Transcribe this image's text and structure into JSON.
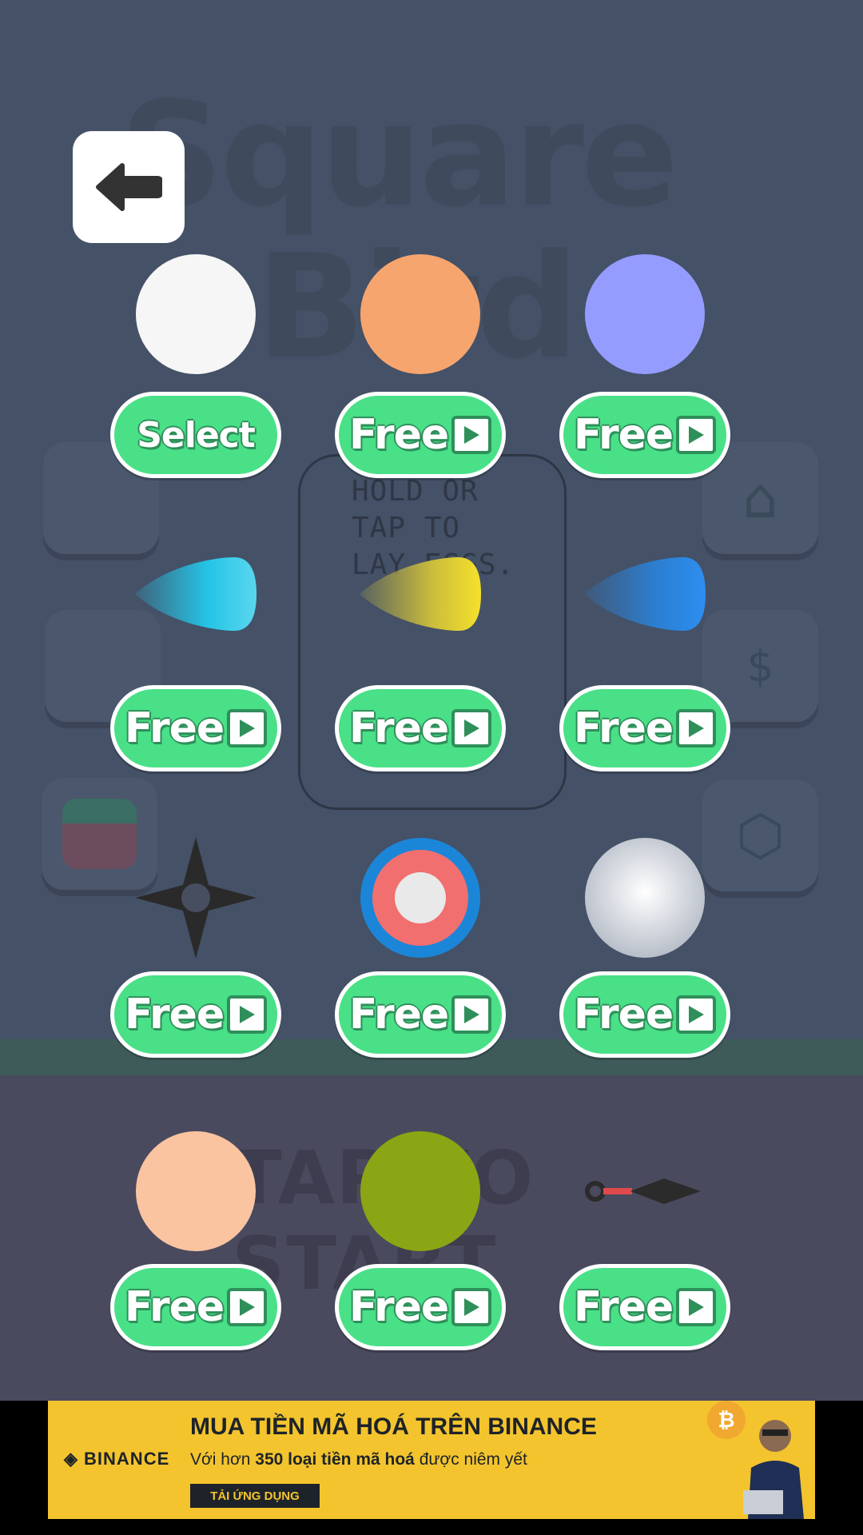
{
  "background": {
    "title_line1": "Square",
    "title_line2": "Bird",
    "hint": "HOLD OR TAP TO LAY EGGS.",
    "tap_to_start": "TAP TO START"
  },
  "back_button": {
    "icon": "arrow-left-icon"
  },
  "skins": [
    {
      "shape": "circle",
      "colors": [
        "#f6f6f6",
        "#e4e4e4"
      ],
      "button": "Select",
      "video": false
    },
    {
      "shape": "circle",
      "colors": [
        "#f7a56e",
        "#f58a6a"
      ],
      "button": "Free",
      "video": true
    },
    {
      "shape": "circle",
      "colors": [
        "#959cff",
        "#8c93f8"
      ],
      "button": "Free",
      "video": true
    },
    {
      "shape": "drop",
      "colors": [
        "#25c4e6",
        "#5ad6ef"
      ],
      "button": "Free",
      "video": true
    },
    {
      "shape": "drop",
      "colors": [
        "#cbbd3c",
        "#f5e12b"
      ],
      "button": "Free",
      "video": true
    },
    {
      "shape": "drop",
      "colors": [
        "#2c7fd2",
        "#2d8ef0"
      ],
      "button": "Free",
      "video": true
    },
    {
      "shape": "shuriken",
      "colors": [
        "#2a2a2a",
        "#1a1a1a"
      ],
      "button": "Free",
      "video": true
    },
    {
      "shape": "target",
      "colors": [
        "#1b86d8",
        "#f16f6f",
        "#e9e9e9"
      ],
      "button": "Free",
      "video": true
    },
    {
      "shape": "pearl",
      "colors": [
        "#ffffff",
        "#b8bec9"
      ],
      "button": "Free",
      "video": true
    },
    {
      "shape": "circle",
      "colors": [
        "#fbc4a0",
        "#f7bf9e"
      ],
      "button": "Free",
      "video": true
    },
    {
      "shape": "circle",
      "colors": [
        "#8aa614",
        "#8aa614"
      ],
      "button": "Free",
      "video": true
    },
    {
      "shape": "kunai",
      "colors": [
        "#2b2b2b",
        "#e04a4a"
      ],
      "button": "Free",
      "video": true
    }
  ],
  "ad": {
    "brand": "BINANCE",
    "headline": "MUA TIỀN MÃ HOÁ TRÊN BINANCE",
    "sub_prefix": "Với hơn",
    "sub_bold": "350 loại tiền mã hoá",
    "sub_suffix": "được niêm yết",
    "cta": "TẢI ỨNG DỤNG",
    "coin_symbol": "₿",
    "accent": "#f3c42d"
  }
}
